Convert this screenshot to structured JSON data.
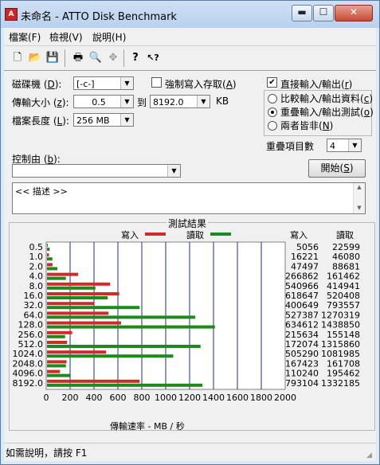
{
  "window": {
    "title": "未命名 - ATTO Disk Benchmark",
    "minimize": "▬",
    "maximize": "☐",
    "close": "✕"
  },
  "menu": [
    {
      "label": "檔案(F)"
    },
    {
      "label": "檢視(V)"
    },
    {
      "label": "說明(H)"
    }
  ],
  "toolbar": [
    {
      "name": "new-icon",
      "glyph": "🗋"
    },
    {
      "name": "open-folder-icon",
      "glyph": "📂"
    },
    {
      "name": "save-icon",
      "glyph": "💾"
    },
    {
      "name": "print-icon",
      "glyph": "🖶"
    },
    {
      "name": "print-preview-icon",
      "glyph": "🔍"
    },
    {
      "name": "move-icon",
      "glyph": "✥"
    },
    {
      "name": "about-icon",
      "glyph": "?"
    },
    {
      "name": "context-help-icon",
      "glyph": "↖?"
    }
  ],
  "form": {
    "drive_label_pre": "磁碟機 (",
    "drive_key": "D",
    "drive_label_post": "):",
    "drive_value": "[-c-]",
    "force_write_pre": "強制寫入存取(",
    "force_write_key": "A",
    "force_write_post": ")",
    "transfer_pre": "傳輸大小 (",
    "transfer_key": "z",
    "transfer_post": "):",
    "transfer_from": "0.5",
    "to_label": "到",
    "transfer_to": "8192.0",
    "kb_label": "KB",
    "length_pre": "檔案長度 (",
    "length_key": "L",
    "length_post": "):",
    "length_value": "256 MB",
    "direct_io_pre": "直接輸入/輸出(",
    "direct_io_key": "r",
    "direct_io_post": ")",
    "direct_io_checked": "✔",
    "compare_pre": "比較輸入/輸出資料(",
    "compare_key": "c",
    "compare_post": ")",
    "overlapped_pre": "重疊輸入/輸出測試(",
    "overlapped_key": "o",
    "overlapped_post": ")",
    "neither_pre": "兩者皆非(",
    "neither_key": "N",
    "neither_post": ")",
    "queue_label": "重疊項目數",
    "queue_value": "4",
    "controlled_pre": "控制由 (",
    "controlled_key": "b",
    "controlled_post": "):",
    "controlled_value": "",
    "start_pre": "開始(",
    "start_key": "S",
    "start_post": ")",
    "description": "<< 描述 >>"
  },
  "results": {
    "title": "測試結果",
    "legend_write": "寫入",
    "legend_read": "讀取",
    "col_write": "寫入",
    "col_read": "讀取",
    "xlabel": "傳輸速率 - MB / 秒"
  },
  "chart_data": {
    "type": "bar",
    "orientation": "horizontal",
    "categories": [
      "0.5",
      "1.0",
      "2.0",
      "4.0",
      "8.0",
      "16.0",
      "32.0",
      "64.0",
      "128.0",
      "256.0",
      "512.0",
      "1024.0",
      "2048.0",
      "4096.0",
      "8192.0"
    ],
    "series": [
      {
        "name": "寫入",
        "color": "#d12a2a",
        "values": [
          5056,
          16221,
          47497,
          266862,
          540966,
          618647,
          400649,
          527387,
          634612,
          215634,
          172074,
          505290,
          167423,
          110240,
          793104
        ]
      },
      {
        "name": "讀取",
        "color": "#1e8a1e",
        "values": [
          22599,
          46080,
          88681,
          161462,
          414941,
          520408,
          793557,
          1270319,
          1438850,
          155148,
          1315860,
          1081985,
          161708,
          195462,
          1332185
        ]
      }
    ],
    "xlim": [
      0,
      2000
    ],
    "xticks": [
      "0",
      "200",
      "400",
      "600",
      "800",
      "1000",
      "1200",
      "1400",
      "1600",
      "1800",
      "2000"
    ],
    "xlabel": "傳輸速率 - MB / 秒",
    "grid": true,
    "legend": "top"
  },
  "status": {
    "text": "如需說明，請按 F1"
  }
}
